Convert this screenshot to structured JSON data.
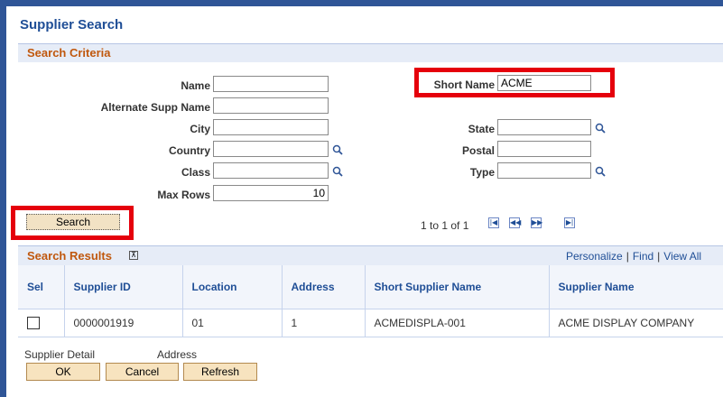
{
  "page": {
    "title": "Supplier Search"
  },
  "criteria": {
    "section_title": "Search Criteria",
    "name_label": "Name",
    "name_value": "",
    "alt_name_label": "Alternate Supp Name",
    "alt_name_value": "",
    "city_label": "City",
    "city_value": "",
    "country_label": "Country",
    "country_value": "",
    "class_label": "Class",
    "class_value": "",
    "max_rows_label": "Max Rows",
    "max_rows_value": "10",
    "short_name_label": "Short Name",
    "short_name_value": "ACME",
    "state_label": "State",
    "state_value": "",
    "postal_label": "Postal",
    "postal_value": "",
    "type_label": "Type",
    "type_value": ""
  },
  "search": {
    "button_label": "Search"
  },
  "navigation": {
    "range_text": "1 to 1 of 1",
    "icons": [
      "first-page-icon",
      "prev-page-icon",
      "next-page-icon",
      "last-page-icon"
    ]
  },
  "results": {
    "title": "Search Results",
    "links": {
      "personalize": "Personalize",
      "find": "Find",
      "view_all": "View All"
    },
    "columns": [
      "Sel",
      "Supplier ID",
      "Location",
      "Address",
      "Short Supplier Name",
      "Supplier Name"
    ],
    "rows": [
      {
        "supplier_id": "0000001919",
        "location": "01",
        "address": "1",
        "short_name": "ACMEDISPLA-001",
        "supplier_name": "ACME DISPLAY COMPANY"
      }
    ]
  },
  "footer": {
    "supplier_detail_label": "Supplier Detail",
    "address_label": "Address",
    "ok_label": "OK",
    "cancel_label": "Cancel",
    "refresh_label": "Refresh"
  },
  "colors": {
    "accent": "#2f5597",
    "section_title": "#c0580e",
    "highlight": "#e5000c"
  }
}
